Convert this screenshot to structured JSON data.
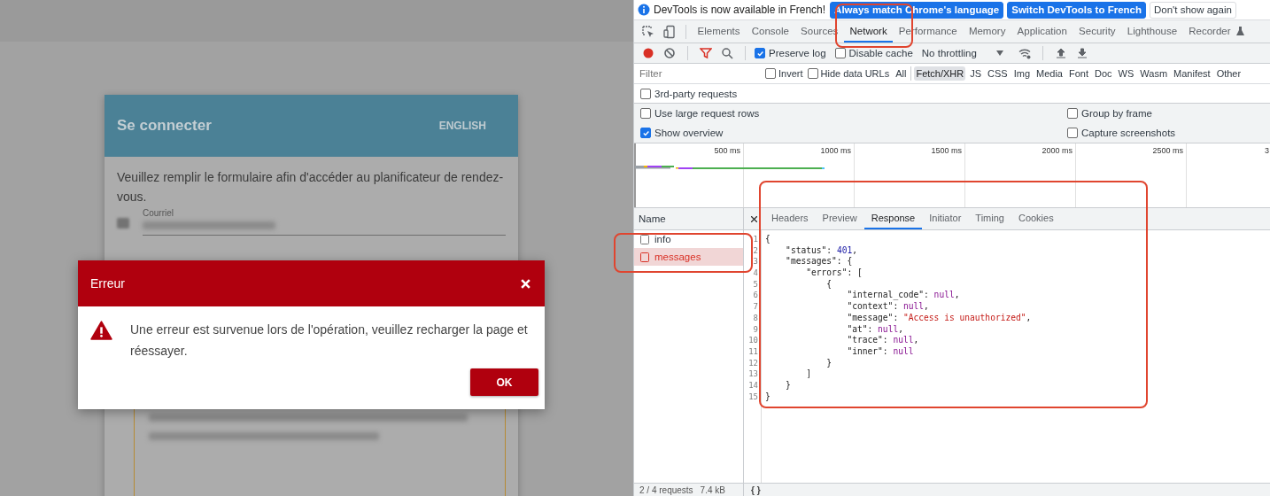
{
  "page": {
    "login_card": {
      "title": "Se connecter",
      "language_button": "ENGLISH",
      "intro": "Veuillez remplir le formulaire afin d'accéder au planificateur de rendez-vous.",
      "email_label": "Courriel"
    },
    "dialog": {
      "title": "Erreur",
      "message": "Une erreur est survenue lors de l'opération, veuillez recharger la page et réessayer.",
      "ok_button": "OK"
    }
  },
  "devtools": {
    "infobar": {
      "message": "DevTools is now available in French!",
      "buttons": [
        {
          "label": "Always match Chrome's language",
          "kind": "primary"
        },
        {
          "label": "Switch DevTools to French",
          "kind": "primary"
        },
        {
          "label": "Don't show again",
          "kind": "plain"
        }
      ]
    },
    "panel_tabs": [
      {
        "label": "Elements",
        "selected": false
      },
      {
        "label": "Console",
        "selected": false
      },
      {
        "label": "Sources",
        "selected": false
      },
      {
        "label": "Network",
        "selected": true
      },
      {
        "label": "Performance",
        "selected": false
      },
      {
        "label": "Memory",
        "selected": false
      },
      {
        "label": "Application",
        "selected": false
      },
      {
        "label": "Security",
        "selected": false
      },
      {
        "label": "Lighthouse",
        "selected": false
      },
      {
        "label": "Recorder",
        "selected": false
      }
    ],
    "toolbar": {
      "options": [
        {
          "label": "Preserve log",
          "checked": true
        },
        {
          "label": "Disable cache",
          "checked": false
        }
      ],
      "throttling": "No throttling"
    },
    "filter": {
      "placeholder": "Filter",
      "options": [
        {
          "label": "Invert",
          "checked": false
        },
        {
          "label": "Hide data URLs",
          "checked": false
        }
      ],
      "types": [
        {
          "label": "All",
          "selected": false
        },
        {
          "label": "Fetch/XHR",
          "selected": true
        },
        {
          "label": "JS",
          "selected": false
        },
        {
          "label": "CSS",
          "selected": false
        },
        {
          "label": "Img",
          "selected": false
        },
        {
          "label": "Media",
          "selected": false
        },
        {
          "label": "Font",
          "selected": false
        },
        {
          "label": "Doc",
          "selected": false
        },
        {
          "label": "WS",
          "selected": false
        },
        {
          "label": "Wasm",
          "selected": false
        },
        {
          "label": "Manifest",
          "selected": false
        },
        {
          "label": "Other",
          "selected": false
        }
      ]
    },
    "third_party": {
      "label": "3rd-party requests",
      "checked": false
    },
    "settings": [
      {
        "label": "Use large request rows",
        "checked": false
      },
      {
        "label": "Group by frame",
        "checked": false
      },
      {
        "label": "Show overview",
        "checked": true
      },
      {
        "label": "Capture screenshots",
        "checked": false
      }
    ],
    "overview": {
      "ticks": [
        "500 ms",
        "1000 ms",
        "1500 ms",
        "2000 ms",
        "2500 ms",
        "3"
      ]
    },
    "requests": {
      "header": "Name",
      "rows": [
        {
          "name": "info",
          "selected": false,
          "error": false
        },
        {
          "name": "messages",
          "selected": true,
          "error": true
        }
      ]
    },
    "detail_tabs": [
      {
        "label": "Headers",
        "selected": false
      },
      {
        "label": "Preview",
        "selected": false
      },
      {
        "label": "Response",
        "selected": true
      },
      {
        "label": "Initiator",
        "selected": false
      },
      {
        "label": "Timing",
        "selected": false
      },
      {
        "label": "Cookies",
        "selected": false
      }
    ],
    "code": [
      {
        "number": "1",
        "tokens": [
          {
            "kind": "plain",
            "text": "{"
          }
        ]
      },
      {
        "number": "2",
        "tokens": [
          {
            "kind": "plain",
            "text": "    \"status\": "
          },
          {
            "kind": "number",
            "text": "401"
          },
          {
            "kind": "plain",
            "text": ","
          }
        ]
      },
      {
        "number": "3",
        "tokens": [
          {
            "kind": "plain",
            "text": "    \"messages\": {"
          }
        ]
      },
      {
        "number": "4",
        "tokens": [
          {
            "kind": "plain",
            "text": "        \"errors\": ["
          }
        ]
      },
      {
        "number": "5",
        "tokens": [
          {
            "kind": "plain",
            "text": "            {"
          }
        ]
      },
      {
        "number": "6",
        "tokens": [
          {
            "kind": "plain",
            "text": "                \"internal_code\": "
          },
          {
            "kind": "null",
            "text": "null"
          },
          {
            "kind": "plain",
            "text": ","
          }
        ]
      },
      {
        "number": "7",
        "tokens": [
          {
            "kind": "plain",
            "text": "                \"context\": "
          },
          {
            "kind": "null",
            "text": "null"
          },
          {
            "kind": "plain",
            "text": ","
          }
        ]
      },
      {
        "number": "8",
        "tokens": [
          {
            "kind": "plain",
            "text": "                \"message\": "
          },
          {
            "kind": "string",
            "text": "\"Access is unauthorized\""
          },
          {
            "kind": "plain",
            "text": ","
          }
        ]
      },
      {
        "number": "9",
        "tokens": [
          {
            "kind": "plain",
            "text": "                \"at\": "
          },
          {
            "kind": "null",
            "text": "null"
          },
          {
            "kind": "plain",
            "text": ","
          }
        ]
      },
      {
        "number": "10",
        "tokens": [
          {
            "kind": "plain",
            "text": "                \"trace\": "
          },
          {
            "kind": "null",
            "text": "null"
          },
          {
            "kind": "plain",
            "text": ","
          }
        ]
      },
      {
        "number": "11",
        "tokens": [
          {
            "kind": "plain",
            "text": "                \"inner\": "
          },
          {
            "kind": "null",
            "text": "null"
          }
        ]
      },
      {
        "number": "12",
        "tokens": [
          {
            "kind": "plain",
            "text": "            }"
          }
        ]
      },
      {
        "number": "13",
        "tokens": [
          {
            "kind": "plain",
            "text": "        ]"
          }
        ]
      },
      {
        "number": "14",
        "tokens": [
          {
            "kind": "plain",
            "text": "    }"
          }
        ]
      },
      {
        "number": "15",
        "tokens": [
          {
            "kind": "plain",
            "text": "}"
          }
        ]
      }
    ],
    "status": {
      "requests": "2 / 4 requests",
      "size": "7.4 kB",
      "format_button": "{ }"
    }
  }
}
